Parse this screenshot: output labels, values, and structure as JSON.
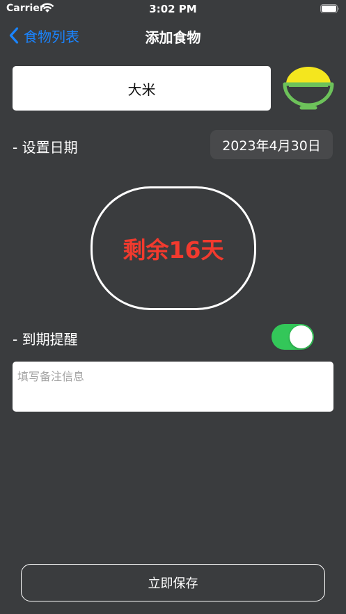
{
  "status_bar": {
    "carrier": "Carrier",
    "time": "3:02 PM"
  },
  "nav": {
    "back_label": "食物列表",
    "title": "添加食物"
  },
  "food": {
    "name": "大米",
    "icon": "rice-bowl-icon"
  },
  "date": {
    "label": "- 设置日期",
    "value": "2023年4月30日"
  },
  "remaining": {
    "text": "剩余16天",
    "color": "#f23a2e"
  },
  "reminder": {
    "label": "- 到期提醒",
    "enabled": true,
    "color": "#33c759"
  },
  "notes": {
    "placeholder": "填写备注信息",
    "value": ""
  },
  "save": {
    "label": "立即保存"
  },
  "colors": {
    "background": "#3a3c3e",
    "accent": "#1a84ff"
  }
}
